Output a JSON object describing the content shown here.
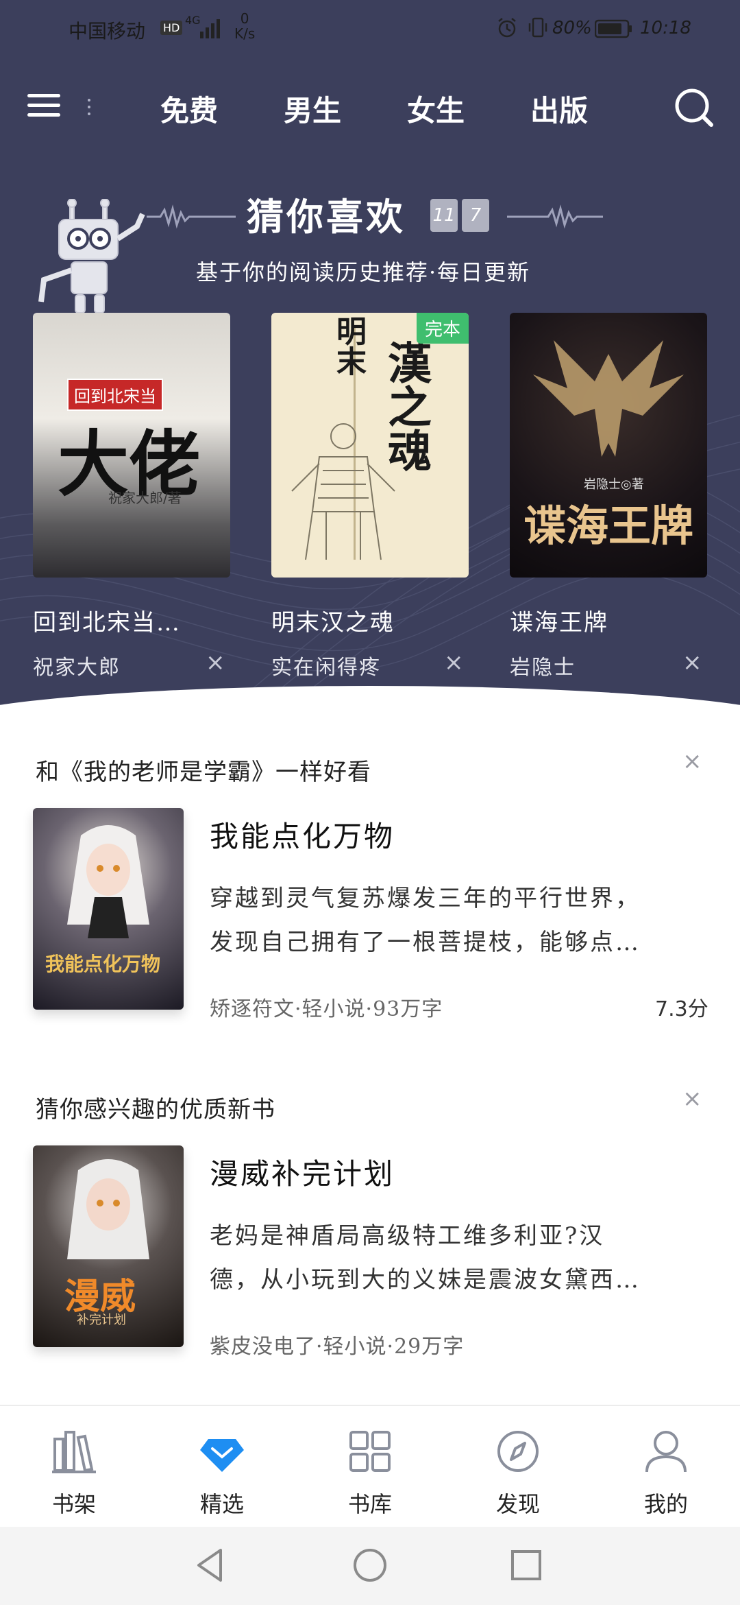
{
  "status": {
    "carrier": "中国移动",
    "hd": "HD",
    "network": "4G",
    "speed_value": "0",
    "speed_unit": "K/s",
    "battery": "80%",
    "time": "10:18"
  },
  "nav": {
    "tabs": [
      "免费",
      "男生",
      "女生",
      "出版"
    ]
  },
  "guess": {
    "title": "猜你喜欢",
    "date_a": "11",
    "date_b": "7",
    "subtitle": "基于你的阅读历史推荐·每日更新",
    "books": [
      {
        "title": "回到北宋当…",
        "author": "祝家大郎",
        "close": "×",
        "cover_text": "大佬",
        "cover_top": "回到北宋当",
        "cover_author": "祝家大郎/著"
      },
      {
        "title": "明末汉之魂",
        "author": "实在闲得疼",
        "close": "×",
        "badge": "完本",
        "cover_text": "漢之魂",
        "cover_side": "明末"
      },
      {
        "title": "谍海王牌",
        "author": "岩隐士",
        "close": "×",
        "cover_text": "谍海王牌",
        "cover_author": "岩隐士◎著"
      }
    ]
  },
  "rec1": {
    "header": "和《我的老师是学霸》一样好看",
    "close": "×",
    "title": "我能点化万物",
    "desc_lines": [
      "穿越到灵气复苏爆发三年的平行世界，",
      "发现自己拥有了一根菩提枝，能够点…"
    ],
    "meta": "矫逐符文·轻小说·93万字",
    "score": "7.3分",
    "cover_text": "我能点化万物"
  },
  "rec2": {
    "header": "猜你感兴趣的优质新书",
    "close": "×",
    "title": "漫威补完计划",
    "desc_lines": [
      "老妈是神盾局高级特工维多利亚?汉",
      "德，从小玩到大的义妹是震波女黛西…"
    ],
    "meta": "紫皮没电了·轻小说·29万字",
    "cover_text": "漫威",
    "cover_sub": "补完计划"
  },
  "tabbar": {
    "items": [
      {
        "label": "书架",
        "icon": "bookshelf-icon"
      },
      {
        "label": "精选",
        "icon": "diamond-icon"
      },
      {
        "label": "书库",
        "icon": "grid-icon"
      },
      {
        "label": "发现",
        "icon": "compass-icon"
      },
      {
        "label": "我的",
        "icon": "person-icon"
      }
    ]
  },
  "colors": {
    "header_bg": "#3c3f5c",
    "accent": "#1e8ef2",
    "badge": "#3fbe6e"
  }
}
